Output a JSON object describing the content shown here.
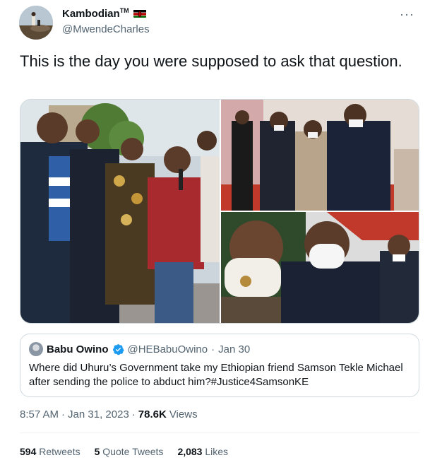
{
  "author": {
    "display_name": "Kambodian",
    "tm": "TM",
    "handle": "@MwendeCharles",
    "flag_icon": "kenya-flag-icon"
  },
  "more_icon": "more-options-icon",
  "tweet": {
    "text": "This is the day you were supposed to ask that question."
  },
  "media": {
    "photo_count": 3
  },
  "quoted_tweet": {
    "name": "Babu Owino",
    "verified_icon": "verified-badge-icon",
    "handle": "@HEBabuOwino",
    "separator": "·",
    "date": "Jan 30",
    "text": "Where did Uhuru’s Government take my Ethiopian friend Samson Tekle Michael after sending the police to abduct him?#Justice4SamsonKE"
  },
  "meta": {
    "time": "8:57 AM",
    "sep1": "·",
    "date": "Jan 31, 2023",
    "sep2": "·",
    "views_count": "78.6K",
    "views_label": "Views"
  },
  "stats": {
    "retweets_count": "594",
    "retweets_label": "Retweets",
    "quotes_count": "5",
    "quotes_label": "Quote Tweets",
    "likes_count": "2,083",
    "likes_label": "Likes"
  },
  "colors": {
    "text": "#0f1419",
    "secondary": "#536471",
    "border": "#cfd9de",
    "verified": "#1d9bf0"
  }
}
